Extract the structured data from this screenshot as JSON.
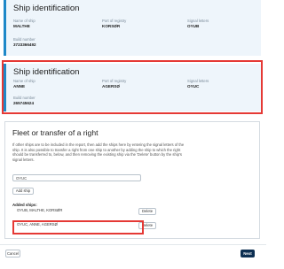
{
  "ship1": {
    "title": "Ship identification",
    "name_label": "Name of ship",
    "name": "MALTHE",
    "port_label": "Port of registry",
    "port": "KORSØR",
    "signal_label": "Signal letters",
    "signal": "OYUB",
    "build_label": "Build number",
    "build": "3723366492"
  },
  "ship2": {
    "title": "Ship identification",
    "name_label": "Name of ship",
    "name": "ANNE",
    "port_label": "Port of registry",
    "port": "AGERSØ",
    "signal_label": "Signal letters",
    "signal": "OYUC",
    "build_label": "Build number",
    "build": "265745624"
  },
  "fleet": {
    "title": "Fleet or transfer of a right",
    "description": "If other ships are to be included in the report, then add the ships here by entering the signal letters of the ship. It is also possible to transfer a right from one ship to another by adding the ship to which the right should be transferred to, below, and then removing the existing ship via the 'Delete' button by the ship's signal letters.",
    "input_value": "OYUC",
    "add_button": "Add ship",
    "added_label": "Added ships:",
    "ships": [
      {
        "text": "OYUB, MALTHE, KORSØR",
        "delete": "Delete"
      },
      {
        "text": "OYUC, ANNE, AGERSØ",
        "delete": "Delete"
      }
    ]
  },
  "footer": {
    "cancel": "Cancel",
    "next": "Next"
  },
  "colors": {
    "accent": "#1e88c8",
    "highlight": "#e53935",
    "primary_button": "#0d2f52"
  }
}
